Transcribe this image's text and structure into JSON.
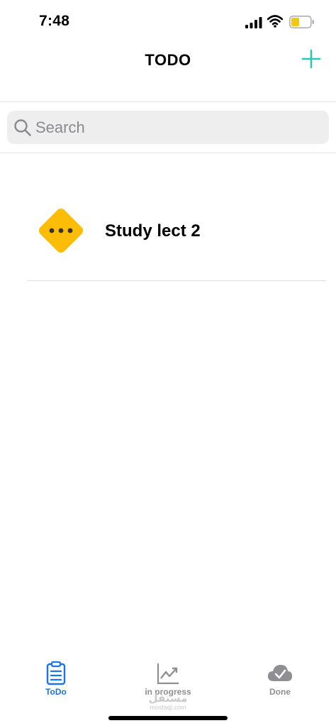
{
  "status_bar": {
    "time": "7:48",
    "icons": [
      "cellular-signal-icon",
      "wifi-icon",
      "battery-icon"
    ],
    "battery_color": "#f5c518"
  },
  "nav": {
    "title": "TODO",
    "add_icon": "plus-icon",
    "accent_color": "#2ec4b6"
  },
  "search": {
    "placeholder": "Search",
    "value": "",
    "icon": "search-icon"
  },
  "tasks": [
    {
      "label": "Study lect 2",
      "icon": "ellipsis-diamond-icon",
      "icon_color": "#fbbd08"
    }
  ],
  "tab_bar": {
    "tabs": [
      {
        "label": "ToDo",
        "icon": "clipboard-list-icon",
        "active": true,
        "color": "#1a73e8"
      },
      {
        "label": "in progress",
        "icon": "trending-up-chart-icon",
        "active": false,
        "color": "#8e8e93"
      },
      {
        "label": "Done",
        "icon": "cloud-check-icon",
        "active": false,
        "color": "#8e8e93"
      }
    ]
  },
  "watermark": {
    "arabic": "مستقل",
    "latin": "mostaql.com"
  }
}
